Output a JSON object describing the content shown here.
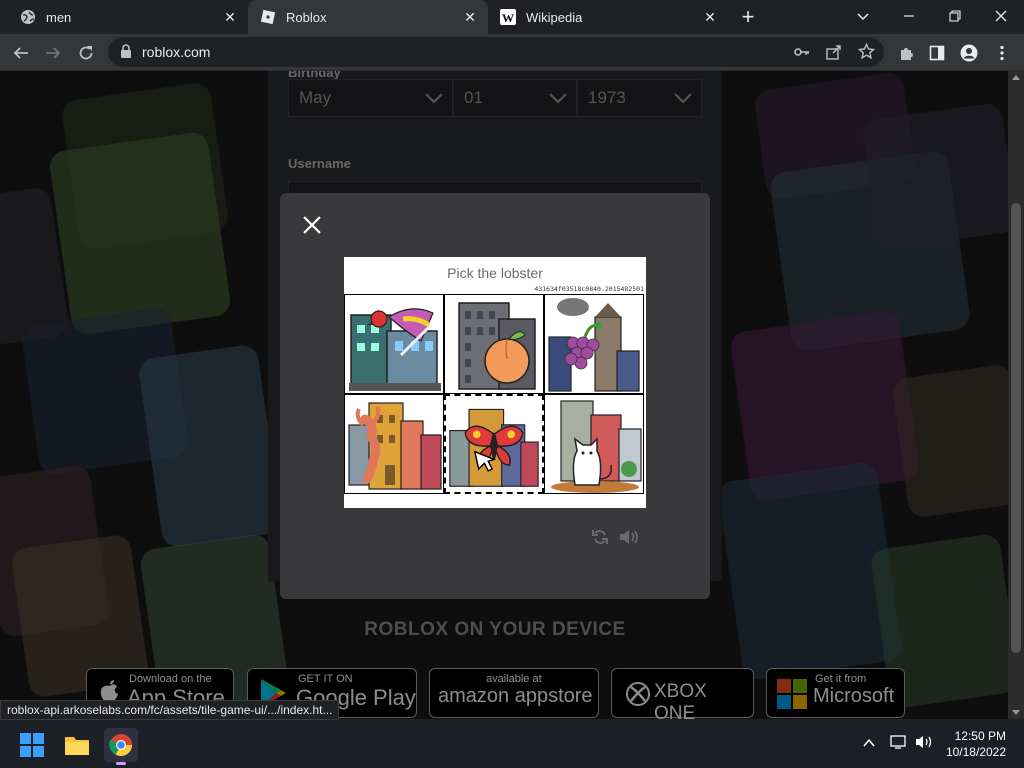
{
  "browser": {
    "tabs": [
      {
        "title": "men",
        "active": false
      },
      {
        "title": "Roblox",
        "active": true
      },
      {
        "title": "Wikipedia",
        "active": false
      }
    ],
    "url": "roblox.com",
    "status_url": "roblox-api.arkoselabs.com/fc/assets/tile-game-ui/.../index.ht..."
  },
  "signup": {
    "birthday_label": "Birthday",
    "month": "May",
    "day": "01",
    "year": "1973",
    "username_label": "Username"
  },
  "captcha": {
    "prompt": "Pick the lobster",
    "challenge_id": "431634f03518c0840.2015482501",
    "tiles": [
      {
        "image": "parrot-building"
      },
      {
        "image": "peach-building"
      },
      {
        "image": "grapes-building"
      },
      {
        "image": "lobster-building"
      },
      {
        "image": "butterfly-building",
        "selected": true
      },
      {
        "image": "cat-building"
      }
    ]
  },
  "device_section": {
    "title": "ROBLOX ON YOUR DEVICE",
    "badges": [
      {
        "small": "Download on the",
        "big": "App Store"
      },
      {
        "small": "GET IT ON",
        "big": "Google Play"
      },
      {
        "small": "available at",
        "big": "amazon appstore"
      },
      {
        "small": "",
        "big": "XBOX ONE"
      },
      {
        "small": "Get it from",
        "big": "Microsoft"
      }
    ]
  },
  "taskbar": {
    "time": "12:50 PM",
    "date": "10/18/2022"
  }
}
